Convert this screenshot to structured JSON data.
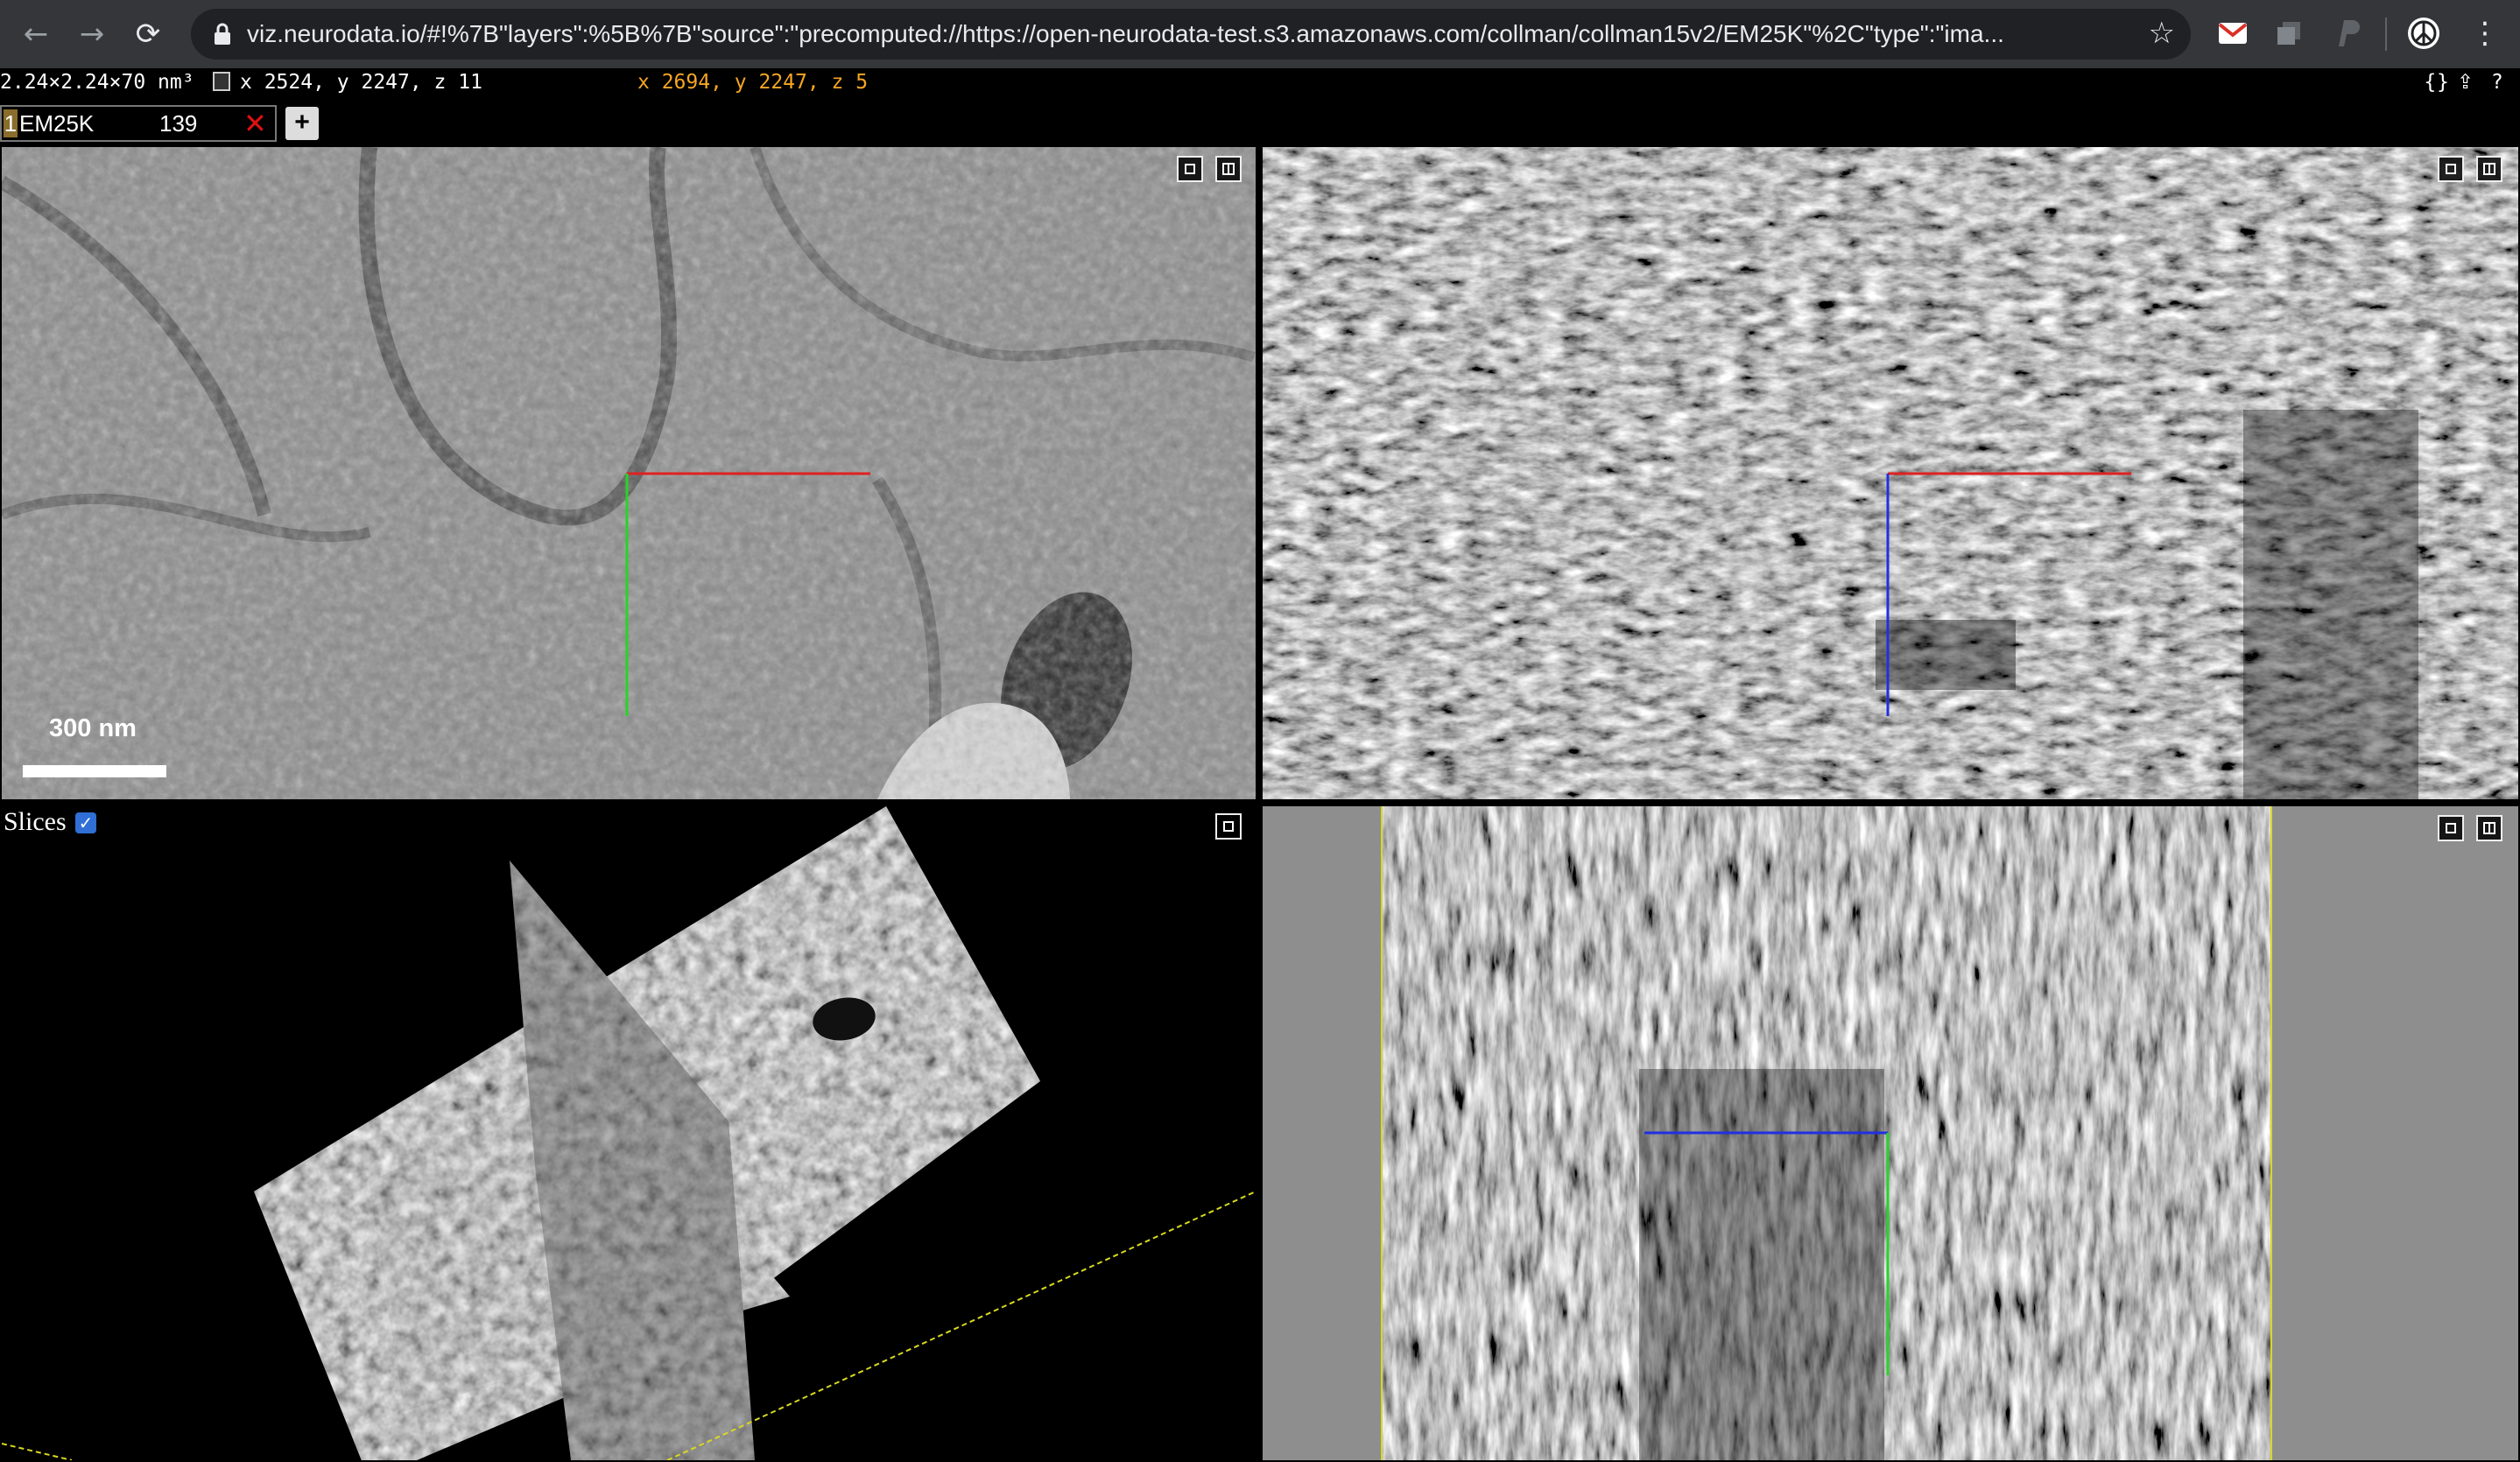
{
  "browser": {
    "url": "viz.neurodata.io/#!%7B\"layers\":%5B%7B\"source\":\"precomputed://https://open-neurodata-test.s3.amazonaws.com/collman/collman15v2/EM25K\"%2C\"type\":\"ima...",
    "back_icon": "←",
    "forward_icon": "→",
    "reload_icon": "⟳",
    "star_icon": "☆",
    "menu_icon": "⋮"
  },
  "toolbar": {
    "voxel_size": "2.24×2.24×70 nm³",
    "mouse_position": "x 2524, y 2247, z 11",
    "cursor_position": "x 2694, y 2247, z 5",
    "json_icon": "{}",
    "share_icon": "⇪",
    "help_icon": "?"
  },
  "layer": {
    "number": "1",
    "name": "EM25K",
    "value": "139",
    "remove_icon": "✕",
    "add_label": "+"
  },
  "panels": {
    "scale_bar": "300 nm",
    "slices_label": "Slices",
    "slices_checked": true
  },
  "colors": {
    "crosshair_red": "#e02020",
    "crosshair_green": "#28d428",
    "crosshair_blue": "#2030e0",
    "bbox_yellow": "#d8d820",
    "cursor_orange": "#f5a623"
  }
}
